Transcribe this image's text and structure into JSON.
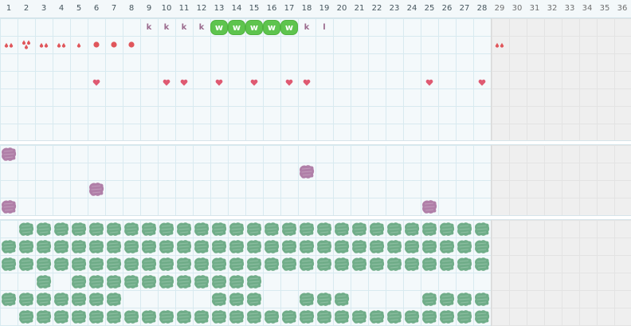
{
  "calendar": {
    "days": [
      1,
      2,
      3,
      4,
      5,
      6,
      7,
      8,
      9,
      10,
      11,
      12,
      13,
      14,
      15,
      16,
      17,
      18,
      19,
      20,
      21,
      22,
      23,
      24,
      25,
      26,
      27,
      28,
      29,
      30,
      31,
      32,
      33,
      34,
      35,
      36
    ],
    "today_index": 28,
    "colors": {
      "drop": "#e0565b",
      "heart": "#df5a72",
      "letter": "#9b6b8e",
      "badge": "#5ec44e",
      "purple_blob": "#b07fa8",
      "green_blob": "#70ad89",
      "future_bg": "#efefef"
    },
    "row1_letters": [
      {
        "day": 9,
        "text": "k"
      },
      {
        "day": 10,
        "text": "k"
      },
      {
        "day": 11,
        "text": "k"
      },
      {
        "day": 12,
        "text": "k"
      },
      {
        "day": 18,
        "text": "k"
      },
      {
        "day": 19,
        "text": "l"
      }
    ],
    "row1_badges": [
      {
        "day": 13,
        "text": "w"
      },
      {
        "day": 14,
        "text": "w"
      },
      {
        "day": 15,
        "text": "w"
      },
      {
        "day": 16,
        "text": "w"
      },
      {
        "day": 17,
        "text": "w"
      }
    ],
    "flow_row": [
      {
        "day": 1,
        "icon": "drops-2"
      },
      {
        "day": 2,
        "icon": "drops-3"
      },
      {
        "day": 3,
        "icon": "drops-2"
      },
      {
        "day": 4,
        "icon": "drops-2"
      },
      {
        "day": 5,
        "icon": "drop-1"
      },
      {
        "day": 6,
        "icon": "spot"
      },
      {
        "day": 7,
        "icon": "spot"
      },
      {
        "day": 8,
        "icon": "spot"
      },
      {
        "day": 29,
        "icon": "drops-2"
      }
    ],
    "heart_days": [
      6,
      10,
      11,
      13,
      15,
      17,
      18,
      25,
      28
    ],
    "purple_marks": [
      {
        "day": 1,
        "row": 0
      },
      {
        "day": 18,
        "row": 1
      },
      {
        "day": 6,
        "row": 2
      },
      {
        "day": 1,
        "row": 3
      },
      {
        "day": 25,
        "row": 3
      }
    ],
    "green_rows": [
      [
        2,
        3,
        4,
        5,
        6,
        7,
        8,
        9,
        10,
        11,
        12,
        13,
        14,
        15,
        16,
        17,
        18,
        19,
        20,
        21,
        22,
        23,
        24,
        25,
        26,
        27,
        28
      ],
      [
        1,
        2,
        3,
        4,
        5,
        6,
        7,
        8,
        9,
        10,
        11,
        12,
        13,
        14,
        15,
        16,
        17,
        18,
        19,
        20,
        21,
        22,
        23,
        24,
        25,
        26,
        27,
        28
      ],
      [
        1,
        2,
        3,
        4,
        5,
        6,
        7,
        8,
        9,
        10,
        11,
        12,
        13,
        14,
        15,
        16,
        17,
        18,
        19,
        20,
        21,
        22,
        23,
        24,
        25,
        26,
        27,
        28
      ],
      [
        3,
        5,
        6,
        7,
        8,
        9,
        10,
        11,
        12,
        13,
        14,
        15
      ],
      [
        1,
        2,
        3,
        4,
        5,
        6,
        7,
        13,
        14,
        15,
        18,
        19,
        20,
        25,
        26,
        27,
        28
      ],
      [
        2,
        3,
        4,
        5,
        6,
        7,
        8,
        9,
        10,
        11,
        12,
        13,
        14,
        15,
        16,
        17,
        18,
        19,
        20,
        21,
        22,
        23,
        24,
        25,
        26,
        27,
        28
      ]
    ]
  }
}
